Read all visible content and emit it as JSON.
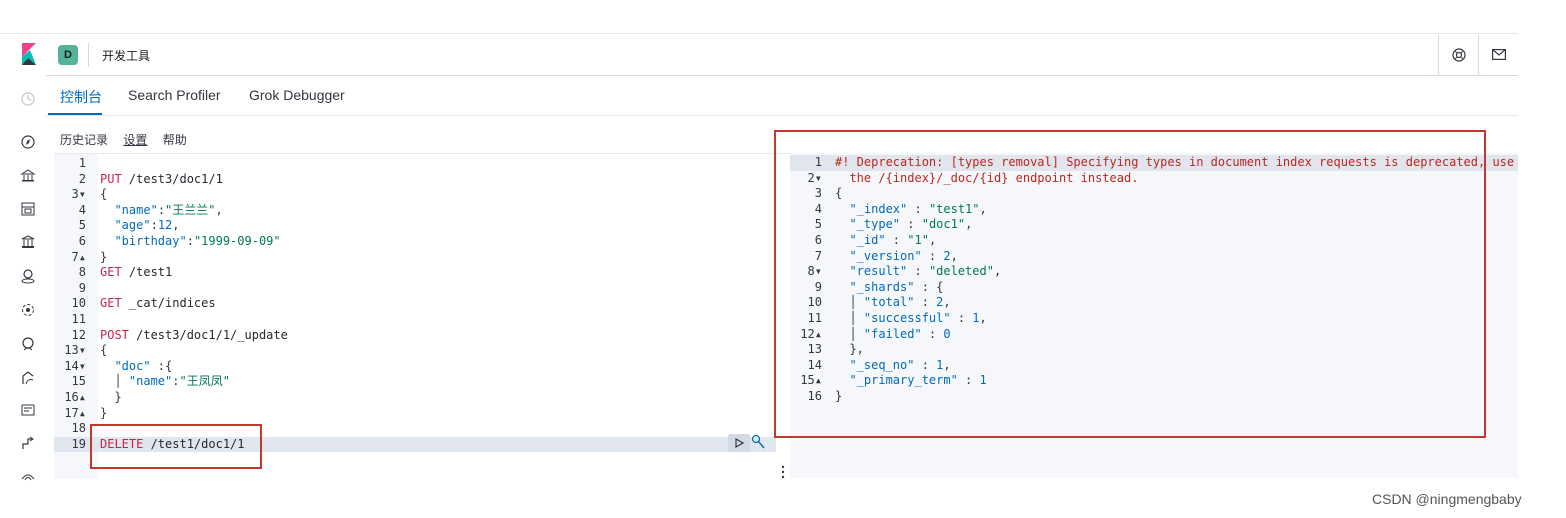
{
  "header": {
    "space_initial": "D",
    "app_title": "开发工具",
    "icons": [
      "help-icon",
      "mail-icon"
    ]
  },
  "sidebar": {
    "icons": [
      "clock-icon",
      "discover-icon",
      "dashboard-icon",
      "canvas-icon",
      "visualize-icon",
      "maps-icon",
      "ml-icon",
      "uptime-icon",
      "apm-icon",
      "logs-icon",
      "stack-management-icon",
      "dev-tools-icon"
    ]
  },
  "tabs": [
    {
      "label": "控制台",
      "active": true
    },
    {
      "label": "Search Profiler",
      "active": false
    },
    {
      "label": "Grok Debugger",
      "active": false
    }
  ],
  "menubar": {
    "history": "历史记录",
    "settings": "设置",
    "help": "帮助"
  },
  "editor": {
    "lines": [
      [],
      [
        [
          "method",
          "PUT"
        ],
        [
          "url",
          " /test3/doc1/1"
        ]
      ],
      [
        [
          "punc",
          "{"
        ]
      ],
      [
        [
          "punc",
          "  "
        ],
        [
          "key",
          "\"name\""
        ],
        [
          "punc",
          ":"
        ],
        [
          "str",
          "\"王兰兰\""
        ],
        [
          "punc",
          ","
        ]
      ],
      [
        [
          "punc",
          "  "
        ],
        [
          "key",
          "\"age\""
        ],
        [
          "punc",
          ":"
        ],
        [
          "num",
          "12"
        ],
        [
          "punc",
          ","
        ]
      ],
      [
        [
          "punc",
          "  "
        ],
        [
          "key",
          "\"birthday\""
        ],
        [
          "punc",
          ":"
        ],
        [
          "str",
          "\"1999-09-09\""
        ]
      ],
      [
        [
          "punc",
          "}"
        ]
      ],
      [
        [
          "method",
          "GET"
        ],
        [
          "url",
          " /test1"
        ]
      ],
      [],
      [
        [
          "method",
          "GET"
        ],
        [
          "url",
          " _cat/indices"
        ]
      ],
      [],
      [
        [
          "method",
          "POST"
        ],
        [
          "url",
          " /test3/doc1/1/_update"
        ]
      ],
      [
        [
          "punc",
          "{"
        ]
      ],
      [
        [
          "punc",
          "  "
        ],
        [
          "key",
          "\"doc\""
        ],
        [
          "punc",
          " :{"
        ]
      ],
      [
        [
          "punc",
          "  │ "
        ],
        [
          "key",
          "\"name\""
        ],
        [
          "punc",
          ":"
        ],
        [
          "str",
          "\"王凤凤\""
        ]
      ],
      [
        [
          "punc",
          "  }"
        ]
      ],
      [
        [
          "punc",
          "}"
        ]
      ],
      [],
      [
        [
          "method",
          "DELETE"
        ],
        [
          "url",
          " /test1/doc1/1"
        ]
      ]
    ],
    "line_numbers": [
      "1",
      "2",
      "3▾",
      "4",
      "5",
      "6",
      "7▴",
      "8",
      "9",
      "10",
      "11",
      "12",
      "13▾",
      "14▾",
      "15",
      "16▴",
      "17▴",
      "18",
      "19"
    ]
  },
  "output": {
    "lines": [
      [
        [
          "warn",
          "#! Deprecation: [types removal] Specifying types in document index requests is deprecated, use"
        ]
      ],
      [
        [
          "warn",
          "  the /{index}/_doc/{id} endpoint instead."
        ]
      ],
      [
        [
          "punc",
          "{"
        ]
      ],
      [
        [
          "punc",
          "  "
        ],
        [
          "key",
          "\"_index\""
        ],
        [
          "punc",
          " : "
        ],
        [
          "str",
          "\"test1\""
        ],
        [
          "punc",
          ","
        ]
      ],
      [
        [
          "punc",
          "  "
        ],
        [
          "key",
          "\"_type\""
        ],
        [
          "punc",
          " : "
        ],
        [
          "str",
          "\"doc1\""
        ],
        [
          "punc",
          ","
        ]
      ],
      [
        [
          "punc",
          "  "
        ],
        [
          "key",
          "\"_id\""
        ],
        [
          "punc",
          " : "
        ],
        [
          "str",
          "\"1\""
        ],
        [
          "punc",
          ","
        ]
      ],
      [
        [
          "punc",
          "  "
        ],
        [
          "key",
          "\"_version\""
        ],
        [
          "punc",
          " : "
        ],
        [
          "num",
          "2"
        ],
        [
          "punc",
          ","
        ]
      ],
      [
        [
          "punc",
          "  "
        ],
        [
          "key",
          "\"result\""
        ],
        [
          "punc",
          " : "
        ],
        [
          "str",
          "\"deleted\""
        ],
        [
          "punc",
          ","
        ]
      ],
      [
        [
          "punc",
          "  "
        ],
        [
          "key",
          "\"_shards\""
        ],
        [
          "punc",
          " : {"
        ]
      ],
      [
        [
          "punc",
          "  │ "
        ],
        [
          "key",
          "\"total\""
        ],
        [
          "punc",
          " : "
        ],
        [
          "num",
          "2"
        ],
        [
          "punc",
          ","
        ]
      ],
      [
        [
          "punc",
          "  │ "
        ],
        [
          "key",
          "\"successful\""
        ],
        [
          "punc",
          " : "
        ],
        [
          "num",
          "1"
        ],
        [
          "punc",
          ","
        ]
      ],
      [
        [
          "punc",
          "  │ "
        ],
        [
          "key",
          "\"failed\""
        ],
        [
          "punc",
          " : "
        ],
        [
          "num",
          "0"
        ]
      ],
      [
        [
          "punc",
          "  },"
        ]
      ],
      [
        [
          "punc",
          "  "
        ],
        [
          "key",
          "\"_seq_no\""
        ],
        [
          "punc",
          " : "
        ],
        [
          "num",
          "1"
        ],
        [
          "punc",
          ","
        ]
      ],
      [
        [
          "punc",
          "  "
        ],
        [
          "key",
          "\"_primary_term\""
        ],
        [
          "punc",
          " : "
        ],
        [
          "num",
          "1"
        ]
      ],
      [
        [
          "punc",
          "}"
        ]
      ],
      []
    ],
    "line_numbers": [
      "1",
      "",
      "2▾",
      "3",
      "4",
      "5",
      "6",
      "7",
      "8▾",
      "9",
      "10",
      "11",
      "12▴",
      "13",
      "14",
      "15▴",
      "16"
    ]
  },
  "watermark": "CSDN @ningmengbaby",
  "colors": {
    "accent": "#006bb8",
    "annotation_red": "#c0392b",
    "space_badge": "#54b399"
  }
}
